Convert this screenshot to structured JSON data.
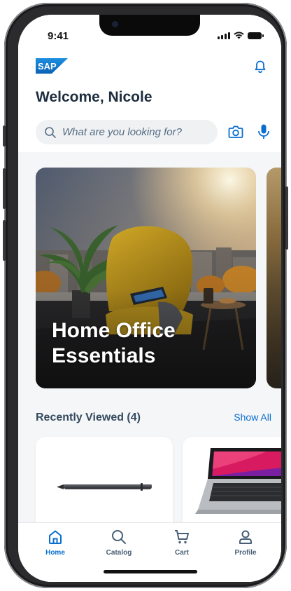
{
  "status_bar": {
    "time": "9:41"
  },
  "header": {
    "brand": "SAP",
    "welcome": "Welcome, Nicole"
  },
  "search": {
    "placeholder": "What are you looking for?"
  },
  "hero": {
    "title": "Home Office Essentials"
  },
  "recently_viewed": {
    "title": "Recently Viewed (4)",
    "show_all": "Show All"
  },
  "tabs": [
    {
      "label": "Home",
      "icon": "home-icon",
      "active": true
    },
    {
      "label": "Catalog",
      "icon": "search-icon",
      "active": false
    },
    {
      "label": "Cart",
      "icon": "cart-icon",
      "active": false
    },
    {
      "label": "Profile",
      "icon": "profile-icon",
      "active": false
    }
  ],
  "colors": {
    "accent": "#0a6ed1",
    "brand_blue": "#0f74c7",
    "title": "#1d2d3e"
  }
}
